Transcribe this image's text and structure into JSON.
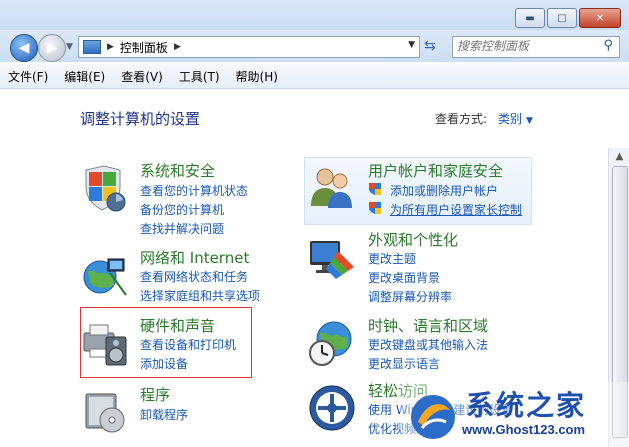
{
  "navbar": {
    "breadcrumb": "控制面板",
    "search_placeholder": "搜索控制面板"
  },
  "menubar": {
    "items": [
      "文件(F)",
      "编辑(E)",
      "查看(V)",
      "工具(T)",
      "帮助(H)"
    ]
  },
  "header": {
    "title": "调整计算机的设置",
    "view_by_label": "查看方式:",
    "view_by_value": "类别"
  },
  "categories": [
    {
      "title": "系统和安全",
      "links": [
        "查看您的计算机状态",
        "备份您的计算机",
        "查找并解决问题"
      ]
    },
    {
      "title": "用户帐户和家庭安全",
      "links": [
        "添加或删除用户帐户",
        "为所有用户设置家长控制"
      ]
    },
    {
      "title": "网络和 Internet",
      "links": [
        "查看网络状态和任务",
        "选择家庭组和共享选项"
      ]
    },
    {
      "title": "外观和个性化",
      "links": [
        "更改主题",
        "更改桌面背景",
        "调整屏幕分辨率"
      ]
    },
    {
      "title": "硬件和声音",
      "links": [
        "查看设备和打印机",
        "添加设备"
      ]
    },
    {
      "title": "时钟、语言和区域",
      "links": [
        "更改键盘或其他输入法",
        "更改显示语言"
      ]
    },
    {
      "title": "程序",
      "links": [
        "卸载程序"
      ]
    },
    {
      "title": "轻松访问",
      "links": [
        "使用 Windows 建议的设置",
        "优化视频显示"
      ]
    }
  ],
  "watermark": {
    "brand": "系统之家",
    "url": "www.Ghost123.com"
  },
  "colors": {
    "category_title": "#2a7a2a",
    "link": "#1a58b5",
    "heading": "#1e3287",
    "highlight_border": "#e23232"
  }
}
